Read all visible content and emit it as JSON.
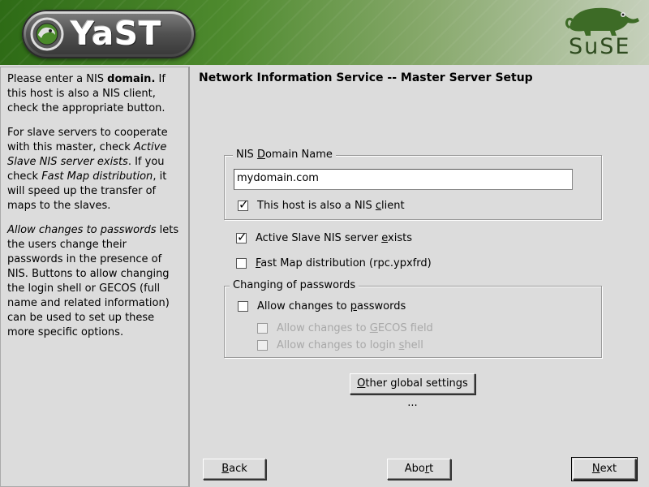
{
  "header": {
    "yast_label": "YaST",
    "suse_label": "SuSE"
  },
  "help": {
    "p1_pre": "Please enter a NIS ",
    "p1_bold": "domain.",
    "p1_post": " If this host is also a NIS client, check the appropriate button.",
    "p2_pre": "For slave servers to cooperate with this master, check ",
    "p2_italic1": "Active Slave NIS server exists",
    "p2_mid": ". If you check ",
    "p2_italic2": "Fast Map distribution",
    "p2_post": ", it will speed up the transfer of maps to the slaves.",
    "p3_italic": "Allow changes to passwords",
    "p3_post": " lets the users change their passwords in the presence of NIS. Buttons to allow changing the login shell or GECOS (full name and related information) can be used to set up these more specific options."
  },
  "main": {
    "title": "Network Information Service -- Master Server Setup",
    "domain_frame_label_pre": "NIS ",
    "domain_frame_label_u": "D",
    "domain_frame_label_post": "omain Name",
    "domain_value": "mydomain.com",
    "nis_client_pre": "This host is also a NIS ",
    "nis_client_u": "c",
    "nis_client_post": "lient",
    "active_slave_pre": "Active Slave NIS server ",
    "active_slave_u": "e",
    "active_slave_post": "xists",
    "fast_map_u": "F",
    "fast_map_post": "ast Map distribution (rpc.ypxfrd)",
    "passwords_frame_label": "Changing of passwords",
    "allow_pw_pre": "Allow changes to ",
    "allow_pw_u": "p",
    "allow_pw_post": "asswords",
    "allow_gecos_pre": "Allow changes to ",
    "allow_gecos_u": "G",
    "allow_gecos_post": "ECOS field",
    "allow_shell_pre": "Allow changes to login ",
    "allow_shell_u": "s",
    "allow_shell_post": "hell",
    "other_settings_u": "O",
    "other_settings_post": "ther global settings ..."
  },
  "footer": {
    "back_u": "B",
    "back_post": "ack",
    "abort_pre": "Abo",
    "abort_u": "r",
    "abort_post": "t",
    "next_u": "N",
    "next_post": "ext"
  },
  "state": {
    "nis_client_checked": true,
    "active_slave_checked": true,
    "fast_map_checked": false,
    "allow_pw_checked": false,
    "allow_gecos_checked": false,
    "allow_shell_checked": false
  },
  "colors": {
    "header_dark_green": "#2e6b16",
    "panel_bg": "#dcdcdc",
    "suse_green": "#2d4a1e"
  }
}
